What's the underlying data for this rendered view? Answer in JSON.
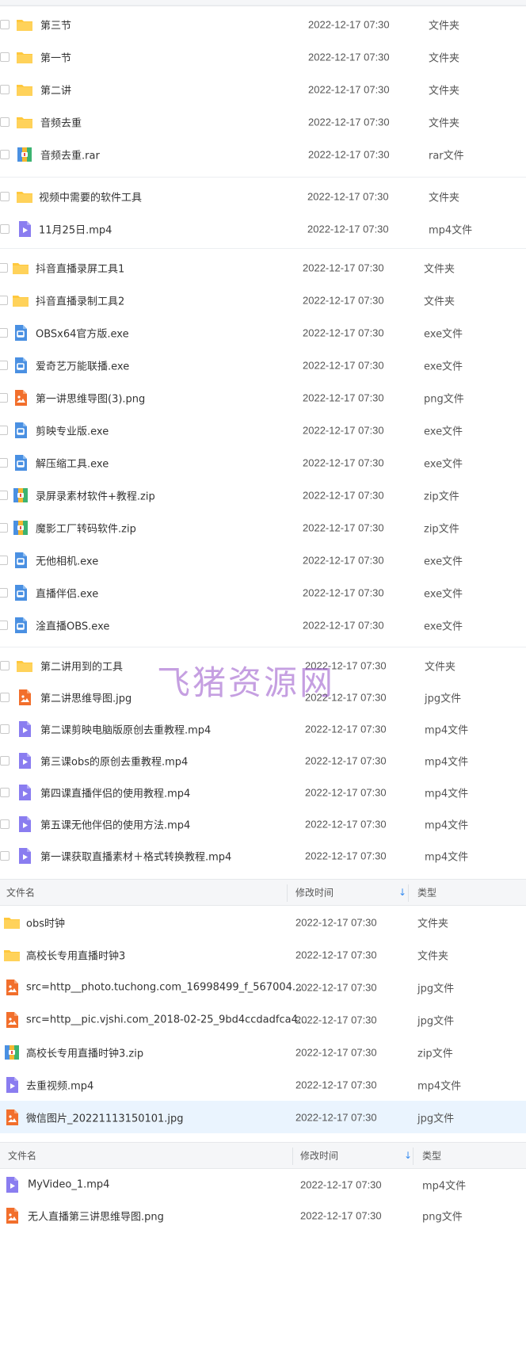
{
  "watermark": "飞猪资源网",
  "colors": {
    "folder": "#ffc83d",
    "video": "#8a7df0",
    "exe": "#4a90e2",
    "image": "#f26f2c",
    "archive": "#e54d4d",
    "selected_row": "#eaf4fe",
    "sort_arrow": "#3b8ef0"
  },
  "panel1": {
    "rows": [
      {
        "name": "第三节",
        "time": "2022-12-17 07:30",
        "type": "文件夹",
        "icon": "folder-icon"
      },
      {
        "name": "第一节",
        "time": "2022-12-17 07:30",
        "type": "文件夹",
        "icon": "folder-icon"
      },
      {
        "name": "第二讲",
        "time": "2022-12-17 07:30",
        "type": "文件夹",
        "icon": "folder-icon"
      },
      {
        "name": "音频去重",
        "time": "2022-12-17 07:30",
        "type": "文件夹",
        "icon": "folder-icon"
      },
      {
        "name": "音频去重.rar",
        "time": "2022-12-17 07:30",
        "type": "rar文件",
        "icon": "archive-icon"
      }
    ]
  },
  "panel2": {
    "rows": [
      {
        "name": "视频中需要的软件工具",
        "time": "2022-12-17 07:30",
        "type": "文件夹",
        "icon": "folder-icon"
      },
      {
        "name": "11月25日.mp4",
        "time": "2022-12-17 07:30",
        "type": "mp4文件",
        "icon": "video-icon"
      }
    ]
  },
  "panel3": {
    "rows": [
      {
        "name": "抖音直播录屏工具1",
        "time": "2022-12-17 07:30",
        "type": "文件夹",
        "icon": "folder-icon"
      },
      {
        "name": "抖音直播录制工具2",
        "time": "2022-12-17 07:30",
        "type": "文件夹",
        "icon": "folder-icon"
      },
      {
        "name": "OBSx64官方版.exe",
        "time": "2022-12-17 07:30",
        "type": "exe文件",
        "icon": "exe-icon"
      },
      {
        "name": "爱奇艺万能联播.exe",
        "time": "2022-12-17 07:30",
        "type": "exe文件",
        "icon": "exe-icon"
      },
      {
        "name": "第一讲思维导图(3).png",
        "time": "2022-12-17 07:30",
        "type": "png文件",
        "icon": "image-icon"
      },
      {
        "name": "剪映专业版.exe",
        "time": "2022-12-17 07:30",
        "type": "exe文件",
        "icon": "exe-icon"
      },
      {
        "name": "解压缩工具.exe",
        "time": "2022-12-17 07:30",
        "type": "exe文件",
        "icon": "exe-icon"
      },
      {
        "name": "录屏录素材软件+教程.zip",
        "time": "2022-12-17 07:30",
        "type": "zip文件",
        "icon": "archive-icon"
      },
      {
        "name": "魔影工厂转码软件.zip",
        "time": "2022-12-17 07:30",
        "type": "zip文件",
        "icon": "archive-icon"
      },
      {
        "name": "无他相机.exe",
        "time": "2022-12-17 07:30",
        "type": "exe文件",
        "icon": "exe-icon"
      },
      {
        "name": "直播伴侣.exe",
        "time": "2022-12-17 07:30",
        "type": "exe文件",
        "icon": "exe-icon"
      },
      {
        "name": "淦直播OBS.exe",
        "time": "2022-12-17 07:30",
        "type": "exe文件",
        "icon": "exe-icon"
      }
    ]
  },
  "panel4": {
    "rows": [
      {
        "name": "第二讲用到的工具",
        "time": "2022-12-17 07:30",
        "type": "文件夹",
        "icon": "folder-icon"
      },
      {
        "name": "第二讲思维导图.jpg",
        "time": "2022-12-17 07:30",
        "type": "jpg文件",
        "icon": "image-icon"
      },
      {
        "name": "第二课剪映电脑版原创去重教程.mp4",
        "time": "2022-12-17 07:30",
        "type": "mp4文件",
        "icon": "video-icon"
      },
      {
        "name": "第三课obs的原创去重教程.mp4",
        "time": "2022-12-17 07:30",
        "type": "mp4文件",
        "icon": "video-icon"
      },
      {
        "name": "第四课直播伴侣的使用教程.mp4",
        "time": "2022-12-17 07:30",
        "type": "mp4文件",
        "icon": "video-icon"
      },
      {
        "name": "第五课无他伴侣的使用方法.mp4",
        "time": "2022-12-17 07:30",
        "type": "mp4文件",
        "icon": "video-icon"
      },
      {
        "name": "第一课获取直播素材＋格式转换教程.mp4",
        "time": "2022-12-17 07:30",
        "type": "mp4文件",
        "icon": "video-icon"
      }
    ]
  },
  "panel5": {
    "header": {
      "name": "文件名",
      "time": "修改时间",
      "type": "类型",
      "sort_arrow": "↓"
    },
    "rows": [
      {
        "name": "obs时钟",
        "time": "2022-12-17 07:30",
        "type": "文件夹",
        "icon": "folder-icon"
      },
      {
        "name": "高校长专用直播时钟3",
        "time": "2022-12-17 07:30",
        "type": "文件夹",
        "icon": "folder-icon"
      },
      {
        "name": "src=http__photo.tuchong.com_16998499_f_567004...",
        "time": "2022-12-17 07:30",
        "type": "jpg文件",
        "icon": "image-icon"
      },
      {
        "name": "src=http__pic.vjshi.com_2018-02-25_9bd4ccdadfca4...",
        "time": "2022-12-17 07:30",
        "type": "jpg文件",
        "icon": "image-icon"
      },
      {
        "name": "高校长专用直播时钟3.zip",
        "time": "2022-12-17 07:30",
        "type": "zip文件",
        "icon": "archive-icon"
      },
      {
        "name": "去重视频.mp4",
        "time": "2022-12-17 07:30",
        "type": "mp4文件",
        "icon": "video-icon"
      },
      {
        "name": "微信图片_20221113150101.jpg",
        "time": "2022-12-17 07:30",
        "type": "jpg文件",
        "icon": "image-icon"
      }
    ]
  },
  "panel6": {
    "header": {
      "name": "文件名",
      "time": "修改时间",
      "type": "类型",
      "sort_arrow": "↓"
    },
    "rows": [
      {
        "name": "MyVideo_1.mp4",
        "time": "2022-12-17 07:30",
        "type": "mp4文件",
        "icon": "video-icon"
      },
      {
        "name": "无人直播第三讲思维导图.png",
        "time": "2022-12-17 07:30",
        "type": "png文件",
        "icon": "image-icon"
      }
    ]
  }
}
